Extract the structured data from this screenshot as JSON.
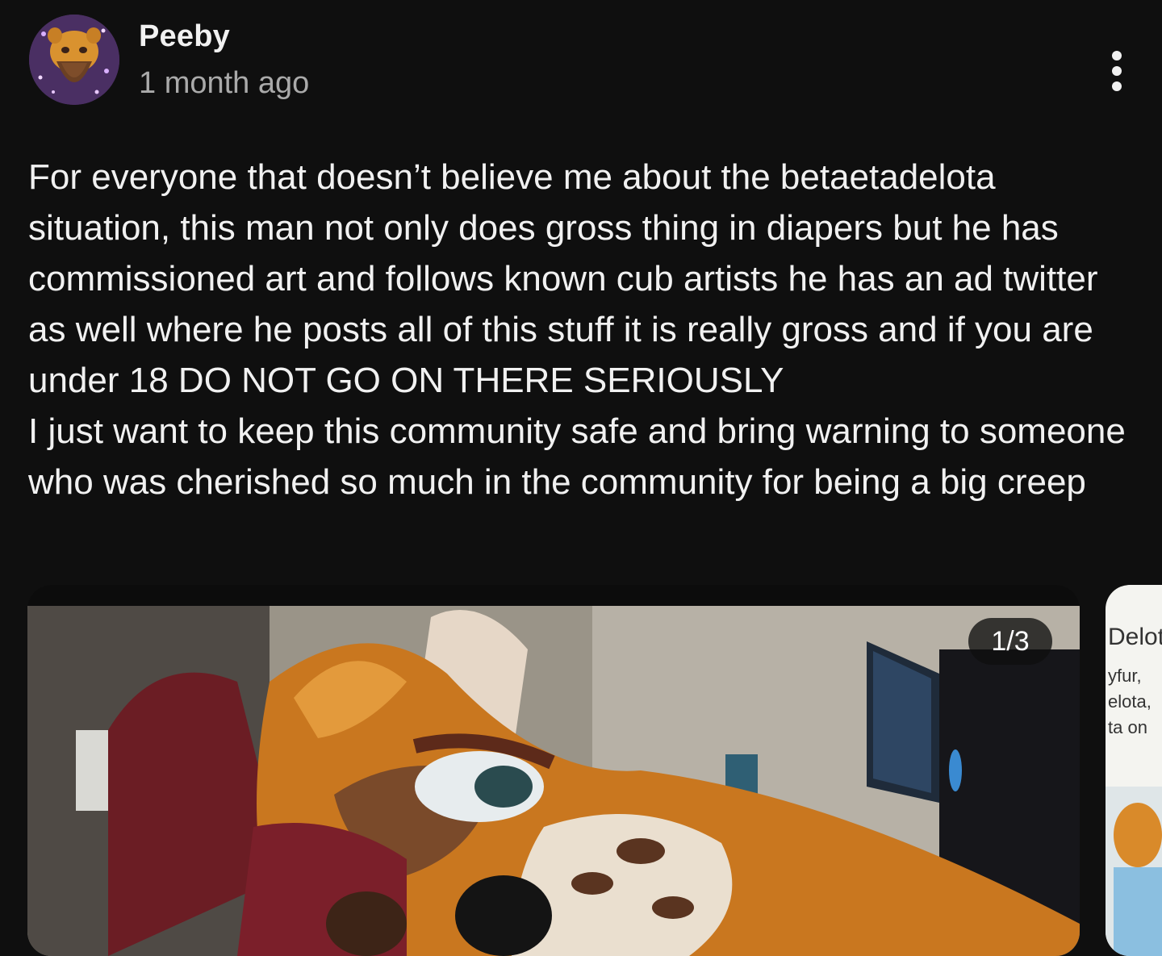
{
  "post": {
    "author": "Peeby",
    "timestamp": "1 month ago",
    "menu_icon": "more-vertical-icon",
    "text": "For everyone that doesn’t believe me about the betaetadelota situation, this man not only does gross thing in diapers but he has commissioned art and follows known cub artists he has an ad twitter as well where he posts all of this stuff it is really gross and if you are under 18 DO NOT GO ON THERE SERIOUSLY\nI just want to keep this community safe and bring warning to someone who was cherished so much in the community for being a big creep"
  },
  "carousel": {
    "counter": "1/3",
    "next_card": {
      "title": "Delot",
      "lines": [
        "yfur,",
        "elota,",
        "ta on"
      ]
    }
  },
  "colors": {
    "background": "#0f0f0f",
    "text_primary": "#f1f1f1",
    "text_secondary": "#aaaaaa"
  }
}
